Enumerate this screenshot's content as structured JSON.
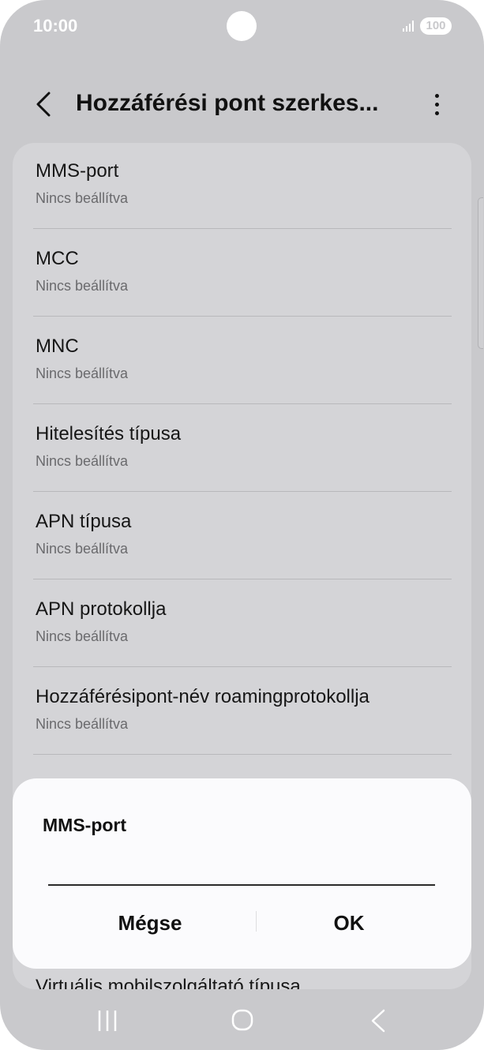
{
  "status_bar": {
    "time": "10:00",
    "battery": "100",
    "icons": [
      "signal-icon",
      "battery-icon"
    ]
  },
  "header": {
    "title": "Hozzáférési pont szerkes...",
    "icons": [
      "back-icon",
      "more-options-icon"
    ]
  },
  "list": {
    "items": [
      {
        "title": "MMS-port",
        "value": "Nincs beállítva"
      },
      {
        "title": "MCC",
        "value": "Nincs beállítva"
      },
      {
        "title": "MNC",
        "value": "Nincs beállítva"
      },
      {
        "title": "Hitelesítés típusa",
        "value": "Nincs beállítva"
      },
      {
        "title": "APN típusa",
        "value": "Nincs beállítva"
      },
      {
        "title": "APN protokollja",
        "value": "Nincs beállítva"
      },
      {
        "title": "Hozzáférésipont-név roamingprotokollja",
        "value": "Nincs beállítva"
      }
    ],
    "partial_item": "Virtuális mobilszolgáltató típusa"
  },
  "dialog": {
    "title": "MMS-port",
    "input_value": "",
    "cancel_label": "Mégse",
    "ok_label": "OK"
  },
  "navbar": {
    "icons": [
      "recent-apps-icon",
      "home-icon",
      "back-nav-icon"
    ]
  },
  "colors": {
    "dim_background": "#c9c9cc",
    "card": "#d4d4d7",
    "dialog": "#fbfbfd",
    "text_primary": "#111111",
    "text_secondary": "#6a6a6d"
  }
}
